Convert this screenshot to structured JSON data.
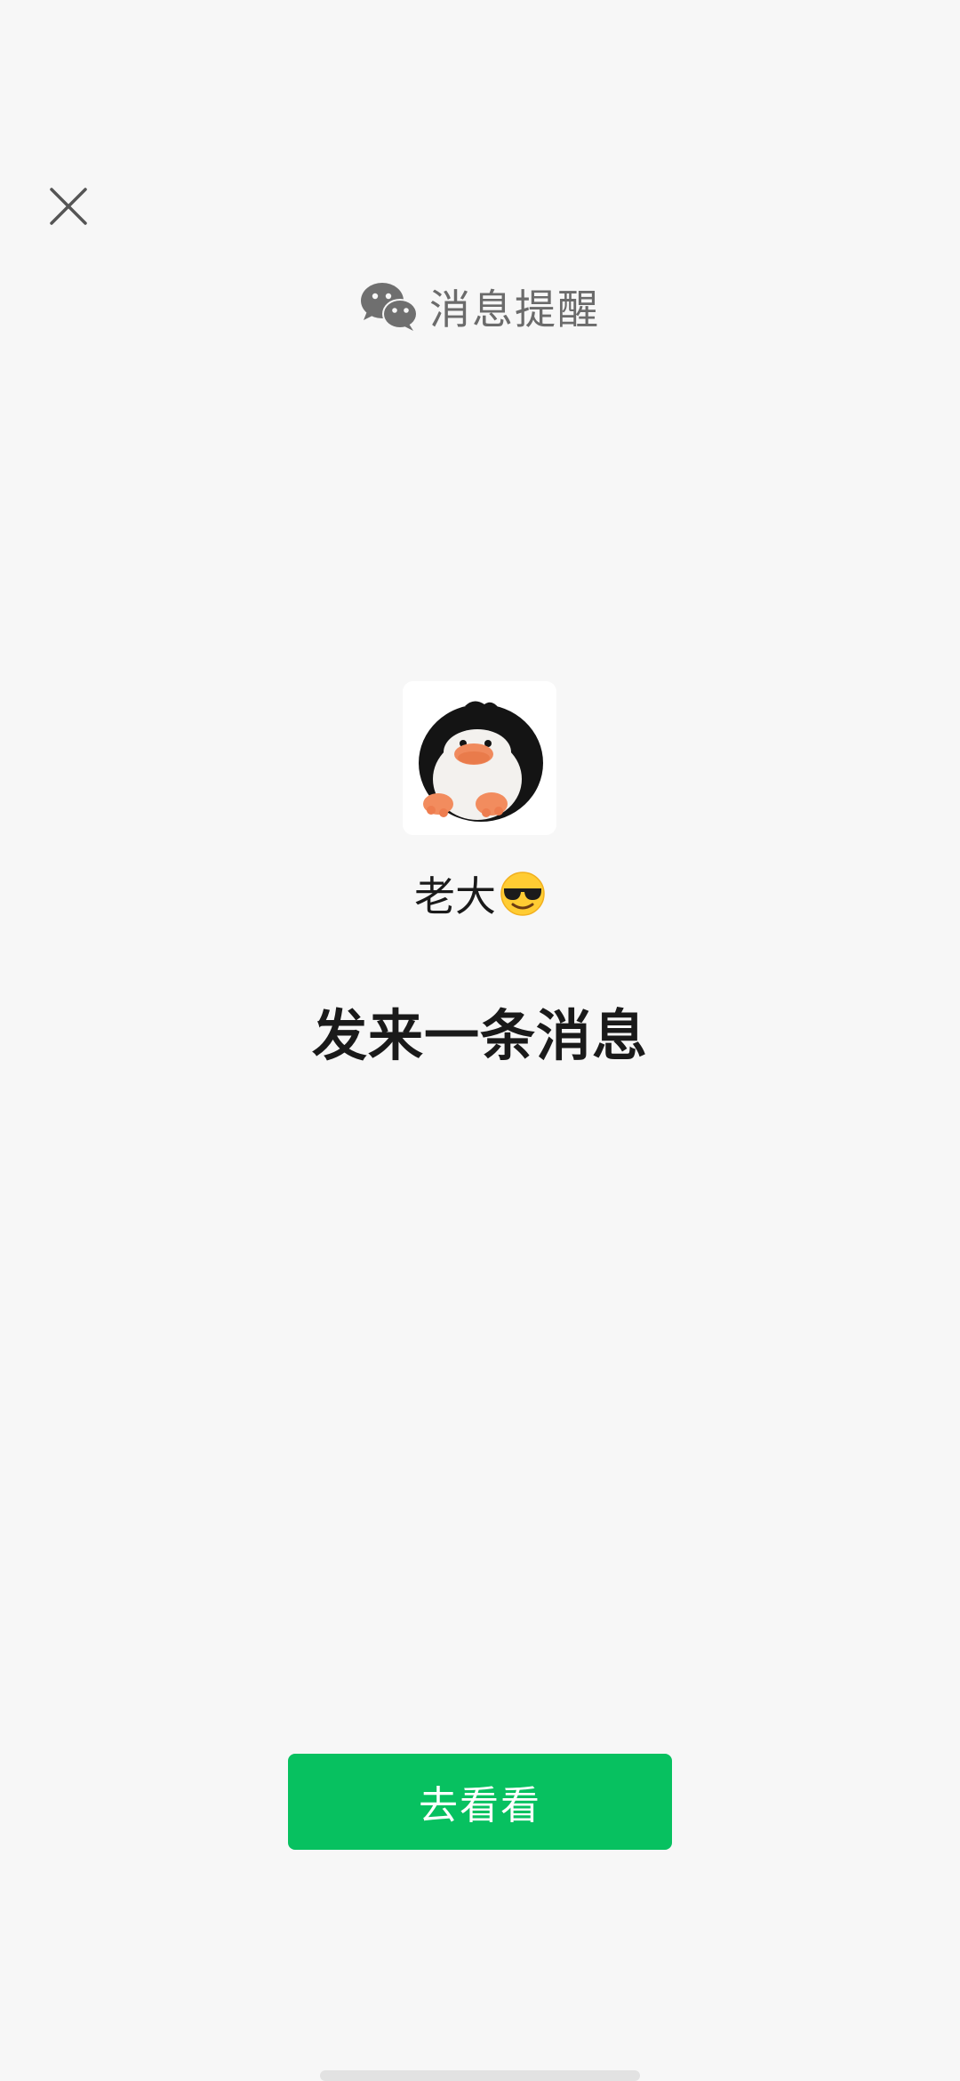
{
  "header": {
    "title": "消息提醒",
    "logo_icon": "wechat-icon"
  },
  "close": {
    "icon": "close-icon"
  },
  "sender": {
    "name": "老大",
    "emoji_icon": "smiling-face-with-sunglasses-icon"
  },
  "message": {
    "text": "发来一条消息"
  },
  "action": {
    "button_label": "去看看"
  },
  "colors": {
    "background": "#f7f7f7",
    "primary_button": "#07c160",
    "title_gray": "#6b6b6b",
    "text_dark": "#1a1a1a"
  }
}
